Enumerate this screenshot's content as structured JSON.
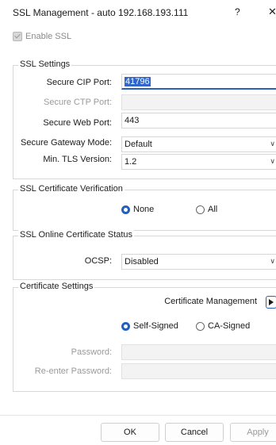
{
  "window": {
    "title": "SSL Management - auto 192.168.193.111",
    "help_label": "?",
    "close_label": "✕"
  },
  "enable_ssl": {
    "label": "Enable SSL",
    "checked": true,
    "disabled": true
  },
  "ssl_settings": {
    "legend": "SSL Settings",
    "secure_cip_port": {
      "label": "Secure CIP Port:",
      "value": "41796"
    },
    "secure_ctp_port": {
      "label": "Secure CTP Port:",
      "value": ""
    },
    "secure_web_port": {
      "label": "Secure Web Port:",
      "value": "443"
    },
    "secure_gateway_mode": {
      "label": "Secure Gateway Mode:",
      "value": "Default"
    },
    "min_tls_version": {
      "label": "Min. TLS Version:",
      "value": "1.2"
    }
  },
  "ssl_cert_verification": {
    "legend": "SSL Certificate Verification",
    "options": [
      "None",
      "All"
    ],
    "selected": "None"
  },
  "ssl_online_cert_status": {
    "legend": "SSL Online Certificate Status",
    "ocsp": {
      "label": "OCSP:",
      "value": "Disabled"
    }
  },
  "certificate_settings": {
    "legend": "Certificate Settings",
    "cert_management_label": "Certificate Management",
    "options": [
      "Self-Signed",
      "CA-Signed"
    ],
    "selected": "Self-Signed",
    "password": {
      "label": "Password:",
      "value": ""
    },
    "reenter_password": {
      "label": "Re-enter Password:",
      "value": ""
    }
  },
  "buttons": {
    "ok": "OK",
    "cancel": "Cancel",
    "apply": "Apply"
  },
  "colors": {
    "accent": "#2060c0",
    "selection": "#3266c8",
    "disabled_text": "#9a9a9a"
  },
  "icons": {
    "chevron": "chevron-down-icon",
    "arrow": "play-arrow-icon"
  }
}
